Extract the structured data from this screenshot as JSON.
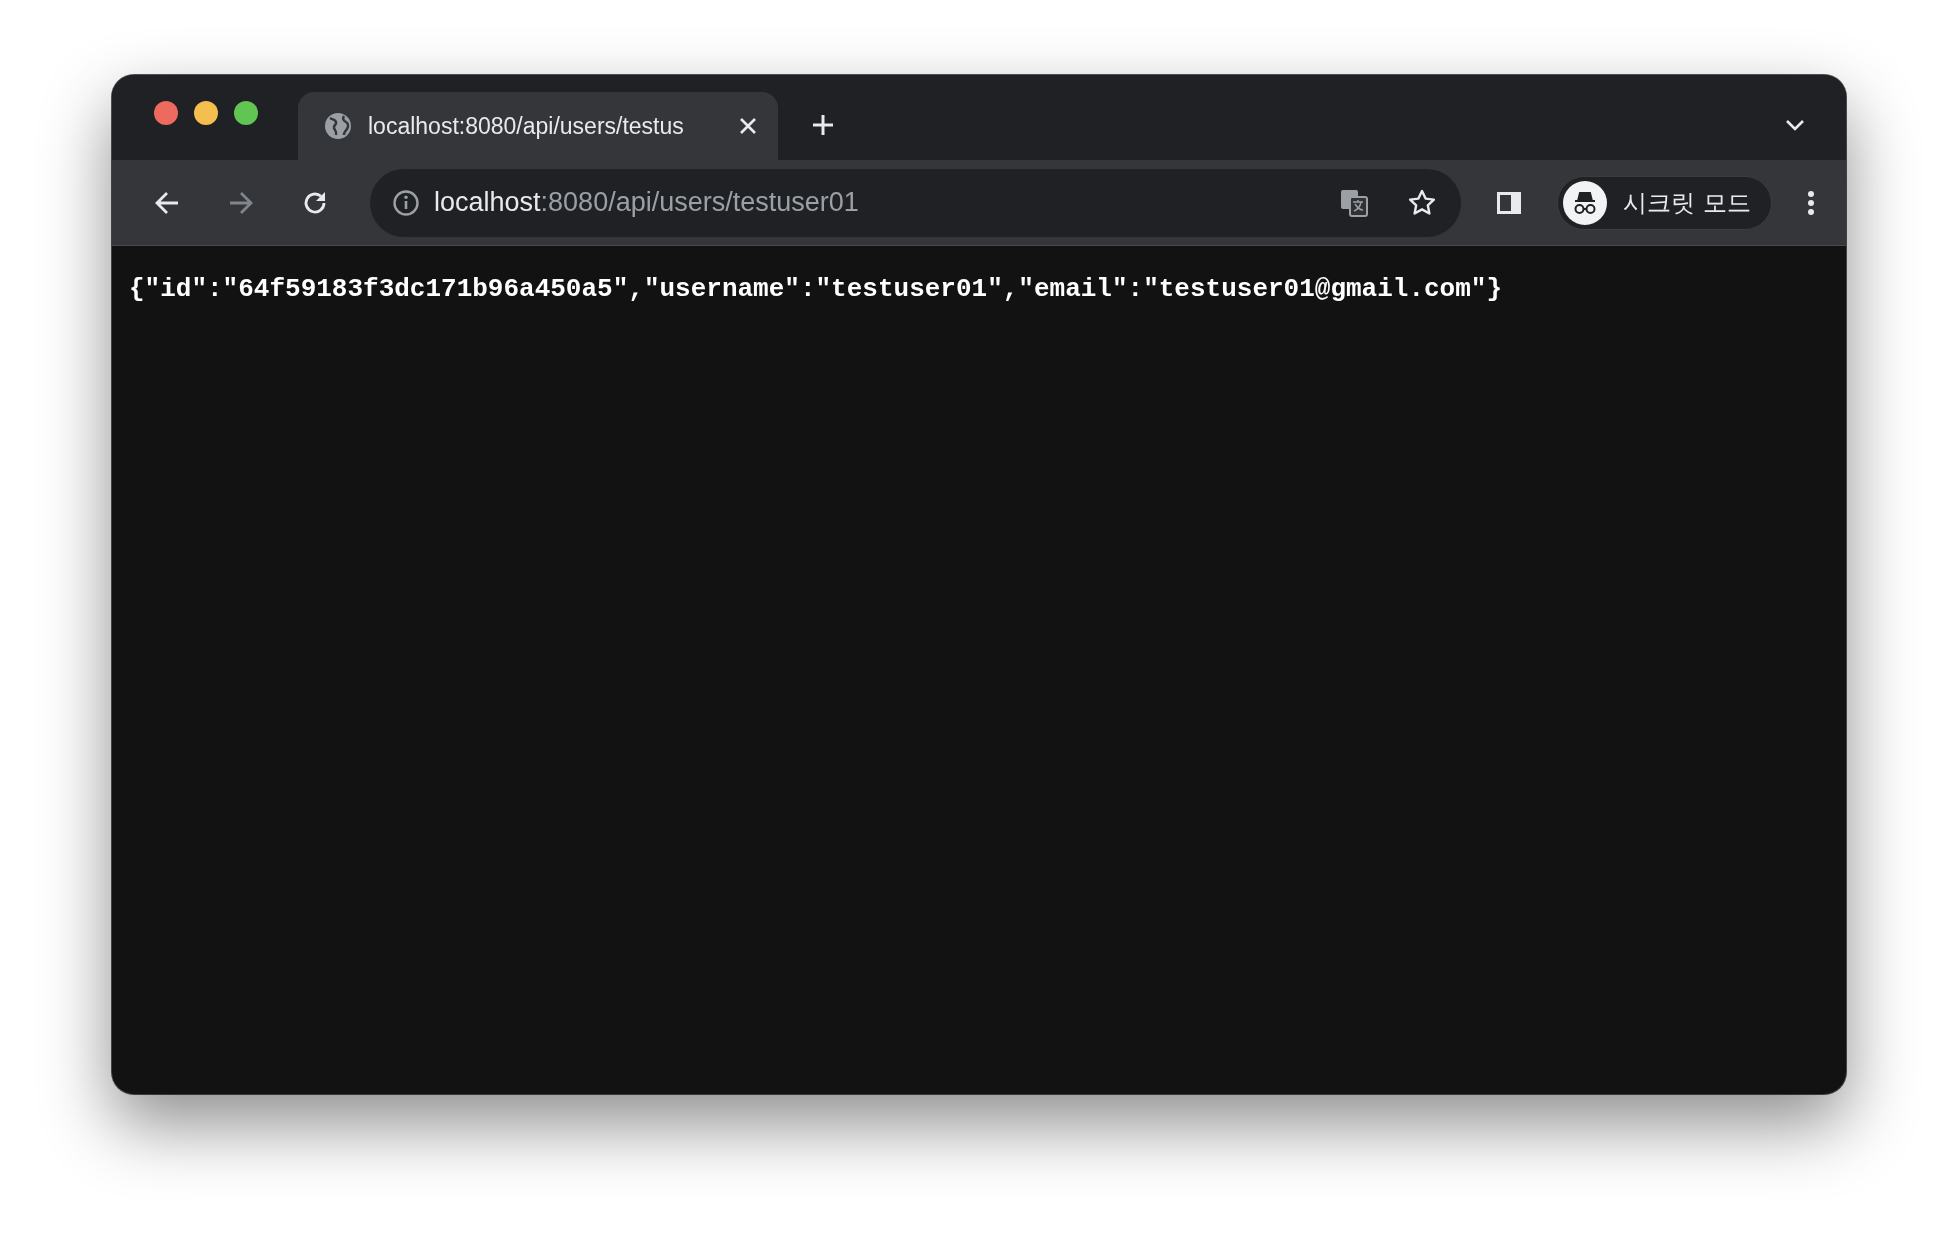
{
  "tabs": [
    {
      "title": "localhost:8080/api/users/testus",
      "selected": true
    }
  ],
  "toolbar": {
    "forward_disabled": true,
    "url": {
      "host": "localhost",
      "rest": ":8080/api/users/testuser01"
    },
    "profile": {
      "label": "시크릿 모드"
    }
  },
  "content": {
    "text": "{\"id\":\"64f59183f3dc171b96a450a5\",\"username\":\"testuser01\",\"email\":\"testuser01@gmail.com\"}"
  }
}
